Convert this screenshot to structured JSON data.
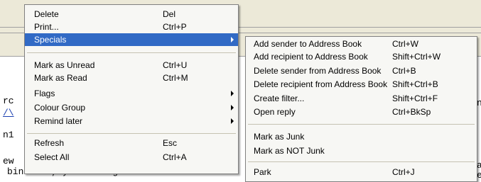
{
  "main_menu": {
    "items": [
      {
        "label": "Delete",
        "shortcut": "Del"
      },
      {
        "label": "Print...",
        "shortcut": "Ctrl+P"
      },
      {
        "label": "Specials",
        "shortcut": "",
        "submenu": true,
        "selected": true
      },
      {
        "label": "Mark as Unread",
        "shortcut": "Ctrl+U"
      },
      {
        "label": "Mark as Read",
        "shortcut": "Ctrl+M"
      },
      {
        "label": "Flags",
        "shortcut": "",
        "submenu": true
      },
      {
        "label": "Colour Group",
        "shortcut": "",
        "submenu": true
      },
      {
        "label": "Remind later",
        "shortcut": "",
        "submenu": true
      },
      {
        "label": "Refresh",
        "shortcut": "Esc"
      },
      {
        "label": "Select All",
        "shortcut": "Ctrl+A"
      }
    ]
  },
  "specials_submenu": {
    "items": [
      {
        "label": "Add sender to Address Book",
        "shortcut": "Ctrl+W"
      },
      {
        "label": "Add recipient to Address Book",
        "shortcut": "Shift+Ctrl+W"
      },
      {
        "label": "Delete sender from Address Book",
        "shortcut": "Ctrl+B"
      },
      {
        "label": "Delete recipient from Address Book",
        "shortcut": "Shift+Ctrl+B"
      },
      {
        "label": "Create filter...",
        "shortcut": "Shift+Ctrl+F"
      },
      {
        "label": "Open reply",
        "shortcut": "Ctrl+BkSp"
      },
      {
        "label": "Mark as Junk",
        "shortcut": ""
      },
      {
        "label": "Mark as NOT Junk",
        "shortcut": ""
      },
      {
        "label": "Park",
        "shortcut": "Ctrl+J"
      }
    ]
  },
  "background": {
    "bottom_line": "bination, you will get a local menu of",
    "left_fragments": [
      "rc",
      "/\\",
      "n1",
      "ew"
    ],
    "right_fragments": [
      "n",
      "a",
      "e"
    ]
  },
  "colors": {
    "selection": "#316ac5",
    "menu_background": "#f7f7f4",
    "window_chrome": "#ece9d8"
  }
}
